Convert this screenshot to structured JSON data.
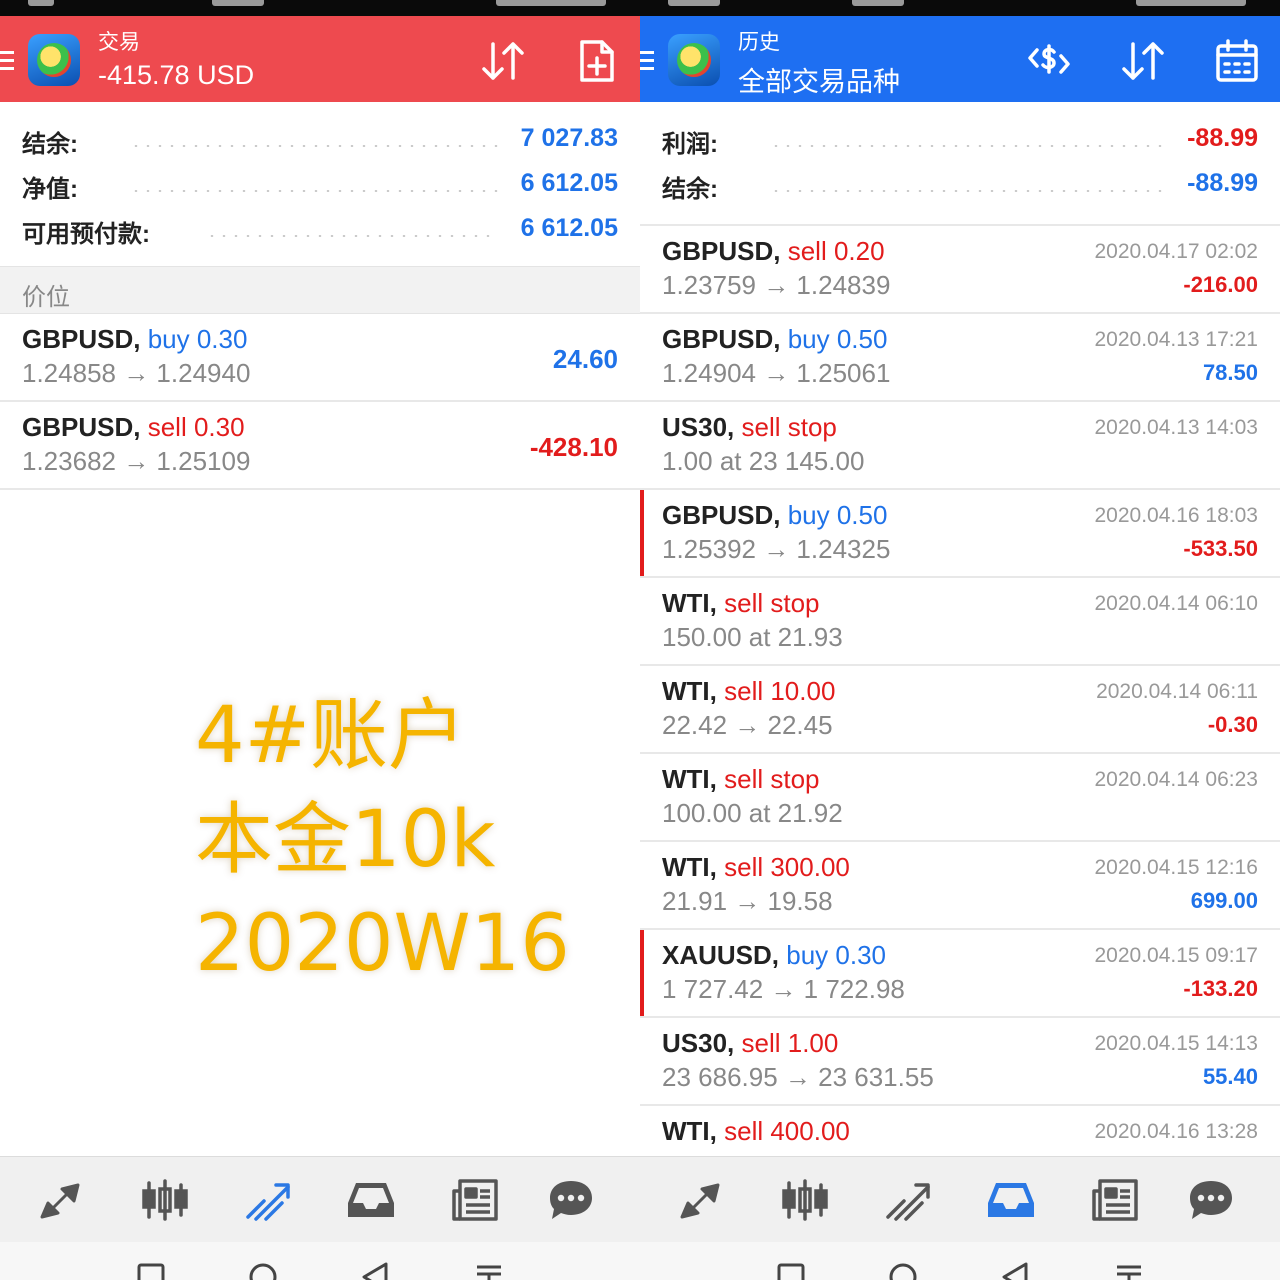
{
  "left": {
    "header": {
      "title": "交易",
      "subtitle": "-415.78 USD"
    },
    "summary": [
      {
        "label": "结余:",
        "value": "7 027.83"
      },
      {
        "label": "净值:",
        "value": "6 612.05"
      },
      {
        "label": "可用预付款:",
        "value": "6 612.05"
      }
    ],
    "section_label": "价位",
    "positions": [
      {
        "symbol": "GBPUSD",
        "side": "buy 0.30",
        "prices": "1.24858 → 1.24940",
        "amount": "24.60"
      },
      {
        "symbol": "GBPUSD",
        "side": "sell 0.30",
        "prices": "1.23682 → 1.25109",
        "amount": "-428.10"
      }
    ]
  },
  "right": {
    "header": {
      "title": "历史",
      "subtitle": "全部交易品种"
    },
    "summary": [
      {
        "label": "利润:",
        "value": "-88.99"
      },
      {
        "label": "结余:",
        "value": "-88.99"
      }
    ],
    "deals": [
      {
        "symbol": "GBPUSD",
        "side": "sell 0.20",
        "prices": "1.23759 → 1.24839",
        "time": "2020.04.17 02:02",
        "profit": "-216.00"
      },
      {
        "symbol": "GBPUSD",
        "side": "buy 0.50",
        "prices": "1.24904 → 1.25061",
        "time": "2020.04.13 17:21",
        "profit": "78.50"
      },
      {
        "symbol": "US30",
        "side": "sell stop",
        "prices": "1.00 at 23 145.00",
        "time": "2020.04.13 14:03",
        "profit": ""
      },
      {
        "symbol": "GBPUSD",
        "side": "buy 0.50",
        "prices": "1.25392 → 1.24325",
        "time": "2020.04.16 18:03",
        "profit": "-533.50"
      },
      {
        "symbol": "WTI",
        "side": "sell stop",
        "prices": "150.00 at 21.93",
        "time": "2020.04.14 06:10",
        "profit": ""
      },
      {
        "symbol": "WTI",
        "side": "sell 10.00",
        "prices": "22.42 → 22.45",
        "time": "2020.04.14 06:11",
        "profit": "-0.30"
      },
      {
        "symbol": "WTI",
        "side": "sell stop",
        "prices": "100.00 at 21.92",
        "time": "2020.04.14 06:23",
        "profit": ""
      },
      {
        "symbol": "WTI",
        "side": "sell 300.00",
        "prices": "21.91 → 19.58",
        "time": "2020.04.15 12:16",
        "profit": "699.00"
      },
      {
        "symbol": "XAUUSD",
        "side": "buy 0.30",
        "prices": "1 727.42 → 1 722.98",
        "time": "2020.04.15 09:17",
        "profit": "-133.20"
      },
      {
        "symbol": "US30",
        "side": "sell 1.00",
        "prices": "23 686.95 → 23 631.55",
        "time": "2020.04.15 14:13",
        "profit": "55.40"
      },
      {
        "symbol": "WTI",
        "side": "sell 400.00",
        "prices": "",
        "time": "2020.04.16 13:28",
        "profit": ""
      }
    ]
  },
  "overlay": {
    "lines": [
      "4#账户",
      "本金10k",
      "2020W16"
    ]
  },
  "colors": {
    "trade_header": "#ee4a4f",
    "history_header": "#1e6ff2",
    "positive": "#1f72e8",
    "negative": "#e21c1c",
    "overlay_text": "#f5b400"
  },
  "icons": {
    "left_header": [
      "sort-icon",
      "new-order-icon"
    ],
    "right_header": [
      "currency-exchange-icon",
      "sort-icon",
      "calendar-icon"
    ],
    "bottom_nav": [
      "quotes-icon",
      "chart-icon",
      "trade-icon",
      "history-icon",
      "news-icon",
      "chat-icon"
    ],
    "system_nav": [
      "square-icon",
      "circle-icon",
      "back-triangle-icon",
      "menu-lines-icon"
    ]
  },
  "active_tabs": {
    "left": "trade-icon",
    "right": "history-icon"
  }
}
